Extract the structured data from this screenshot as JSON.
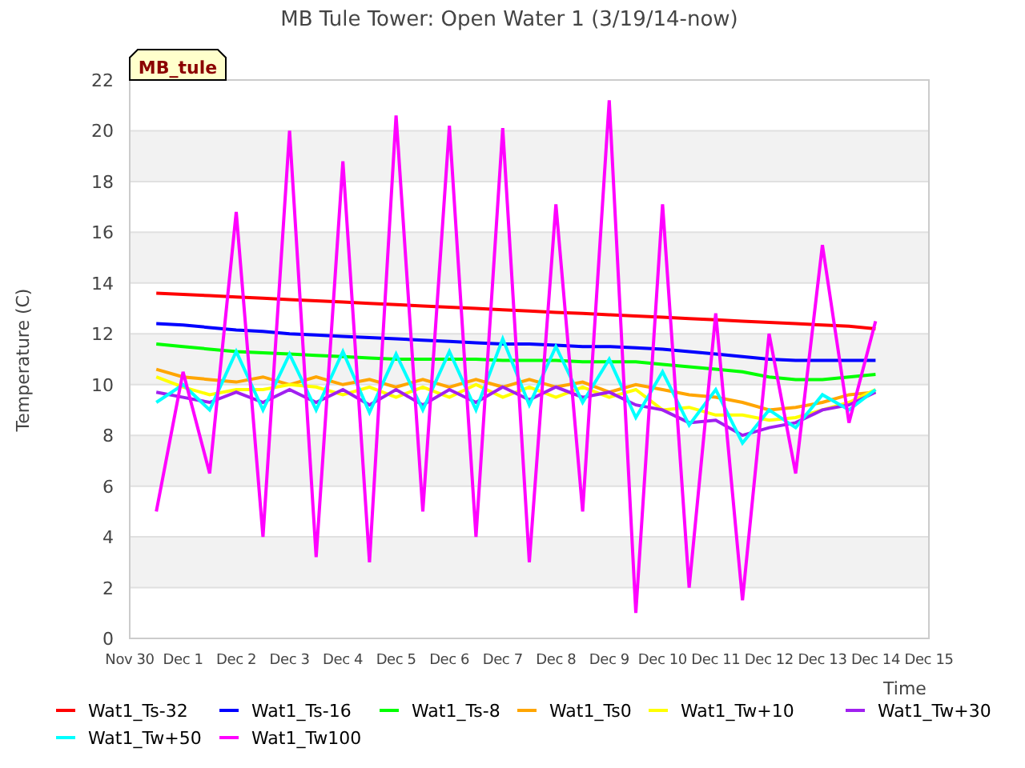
{
  "chart": {
    "station_tag": "MB_tule",
    "chart_data": {
      "type": "line",
      "title": "MB Tule Tower: Open Water 1 (3/19/14-now)",
      "xlabel": "Time",
      "ylabel": "Temperature (C)",
      "categories": [
        "Nov 30",
        null,
        "Dec 1",
        null,
        "Dec 2",
        null,
        "Dec 3",
        null,
        "Dec 4",
        null,
        "Dec 5",
        null,
        "Dec 6",
        null,
        "Dec 7",
        null,
        "Dec 8",
        null,
        "Dec 9",
        null,
        "Dec 10",
        null,
        "Dec 11",
        null,
        "Dec 12",
        null,
        "Dec 13",
        null,
        "Dec 14",
        null,
        "Dec 15"
      ],
      "ylim": [
        0,
        22
      ],
      "grid": true,
      "legend": true,
      "yticks": [
        0,
        2,
        4,
        6,
        8,
        10,
        12,
        14,
        16,
        18,
        20,
        22
      ],
      "series": [
        {
          "name": "Wat1_Ts-32",
          "color": "#ff0000",
          "values": [
            null,
            13.6,
            13.55,
            13.5,
            13.45,
            13.4,
            13.35,
            13.3,
            13.25,
            13.2,
            13.15,
            13.1,
            13.05,
            13.0,
            12.95,
            12.9,
            12.85,
            12.8,
            12.75,
            12.7,
            12.65,
            12.6,
            12.55,
            12.5,
            12.45,
            12.4,
            12.35,
            12.3,
            12.2,
            null,
            null
          ]
        },
        {
          "name": "Wat1_Ts-16",
          "color": "#0000ff",
          "values": [
            null,
            12.4,
            12.35,
            12.25,
            12.15,
            12.1,
            12.0,
            11.95,
            11.9,
            11.85,
            11.8,
            11.75,
            11.7,
            11.65,
            11.6,
            11.6,
            11.55,
            11.5,
            11.5,
            11.45,
            11.4,
            11.3,
            11.2,
            11.1,
            11.0,
            10.95,
            10.95,
            10.95,
            10.95,
            null,
            null
          ]
        },
        {
          "name": "Wat1_Ts-8",
          "color": "#00ff00",
          "values": [
            null,
            11.6,
            11.5,
            11.4,
            11.3,
            11.25,
            11.2,
            11.15,
            11.1,
            11.05,
            11.0,
            11.0,
            11.0,
            11.0,
            10.95,
            10.95,
            10.95,
            10.9,
            10.9,
            10.9,
            10.8,
            10.7,
            10.6,
            10.5,
            10.3,
            10.2,
            10.2,
            10.3,
            10.4,
            null,
            null
          ]
        },
        {
          "name": "Wat1_Ts0",
          "color": "#ffa500",
          "values": [
            null,
            10.6,
            10.3,
            10.2,
            10.1,
            10.3,
            10.0,
            10.3,
            10.0,
            10.2,
            9.9,
            10.2,
            9.9,
            10.2,
            9.9,
            10.2,
            9.9,
            10.1,
            9.7,
            10.0,
            9.8,
            9.6,
            9.5,
            9.3,
            9.0,
            9.1,
            9.3,
            9.6,
            9.7,
            null,
            null
          ]
        },
        {
          "name": "Wat1_Tw+10",
          "color": "#ffff00",
          "values": [
            null,
            10.3,
            9.9,
            9.6,
            9.8,
            9.8,
            10.0,
            9.9,
            9.6,
            9.9,
            9.5,
            9.9,
            9.5,
            10.0,
            9.5,
            9.9,
            9.5,
            9.9,
            9.5,
            9.8,
            9.0,
            9.1,
            8.8,
            8.8,
            8.6,
            8.7,
            9.0,
            9.3,
            9.8,
            null,
            null
          ]
        },
        {
          "name": "Wat1_Tw+30",
          "color": "#a020f0",
          "values": [
            null,
            9.7,
            9.5,
            9.3,
            9.7,
            9.3,
            9.8,
            9.3,
            9.8,
            9.2,
            9.8,
            9.2,
            9.8,
            9.3,
            9.9,
            9.4,
            9.9,
            9.5,
            9.7,
            9.2,
            9.0,
            8.5,
            8.6,
            8.0,
            8.3,
            8.5,
            9.0,
            9.2,
            9.7,
            null,
            null
          ]
        },
        {
          "name": "Wat1_Tw+50",
          "color": "#00ffff",
          "values": [
            null,
            9.3,
            10.0,
            9.0,
            11.3,
            9.0,
            11.2,
            9.0,
            11.3,
            8.9,
            11.2,
            9.0,
            11.3,
            9.0,
            11.8,
            9.2,
            11.5,
            9.3,
            11.0,
            8.7,
            10.5,
            8.4,
            9.8,
            7.7,
            9.0,
            8.3,
            9.6,
            9.0,
            9.8,
            null,
            null
          ]
        },
        {
          "name": "Wat1_Tw100",
          "color": "#ff00ff",
          "values": [
            null,
            5.0,
            10.5,
            6.5,
            16.8,
            4.0,
            20.0,
            3.2,
            18.8,
            3.0,
            20.6,
            5.0,
            20.2,
            4.0,
            20.1,
            3.0,
            17.1,
            5.0,
            21.2,
            1.0,
            17.1,
            2.0,
            12.8,
            1.5,
            12.0,
            6.5,
            15.5,
            8.5,
            12.5,
            null,
            null
          ]
        }
      ]
    }
  }
}
